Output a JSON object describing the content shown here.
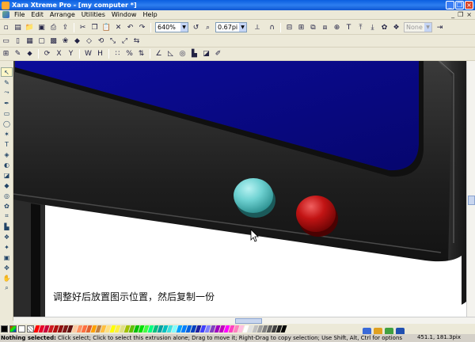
{
  "window": {
    "title": "Xara Xtreme Pro - [my computer *]",
    "buttons": [
      "_",
      "❐",
      "×"
    ]
  },
  "menu": {
    "items": [
      "File",
      "Edit",
      "Arrange",
      "Utilities",
      "Window",
      "Help"
    ],
    "right_buttons": [
      "_",
      "❐",
      "×"
    ]
  },
  "toolbar1": {
    "zoom_value": "640%",
    "line_width_value": "0.67pi",
    "style_value": "None"
  },
  "canvas": {
    "caption": "调整好后放置图示位置，然后复制一份"
  },
  "colors": {
    "screen_blue": "#0a0a8c",
    "bezel_dark": "#1e1e1e",
    "button_cyan": "#6fd2d2",
    "button_red": "#c21414"
  },
  "palette": [
    "#ff0000",
    "#e8002a",
    "#c8003a",
    "#d01a20",
    "#b01010",
    "#901010",
    "#801818",
    "#601010",
    "#ffc8a0",
    "#ff9060",
    "#ff7040",
    "#e06030",
    "#ffa000",
    "#c08040",
    "#ffc040",
    "#ffe080",
    "#ffff00",
    "#fff040",
    "#e0e080",
    "#a0c000",
    "#60c000",
    "#00c000",
    "#00e000",
    "#40ff40",
    "#00ff80",
    "#00c080",
    "#00a0a0",
    "#00c0c0",
    "#40e0e0",
    "#80ffff",
    "#00a0ff",
    "#0080ff",
    "#0060e0",
    "#0040c0",
    "#2020a0",
    "#4040ff",
    "#8080ff",
    "#8040c0",
    "#a000c0",
    "#c000c0",
    "#ff00ff",
    "#ff40c0",
    "#ff80c0",
    "#ffc0e0",
    "#ffffff",
    "#e0e0e0",
    "#c0c0c0",
    "#a0a0a0",
    "#808080",
    "#606060",
    "#404040",
    "#202020",
    "#000000"
  ],
  "status": {
    "bold": "Nothing selected:",
    "text": "Click select; Click to select this extrusion alone; Drag to move it; Right-Drag to copy selection; Use Shift, Alt, Ctrl for options",
    "coords": "451.1, 181.3pix"
  }
}
